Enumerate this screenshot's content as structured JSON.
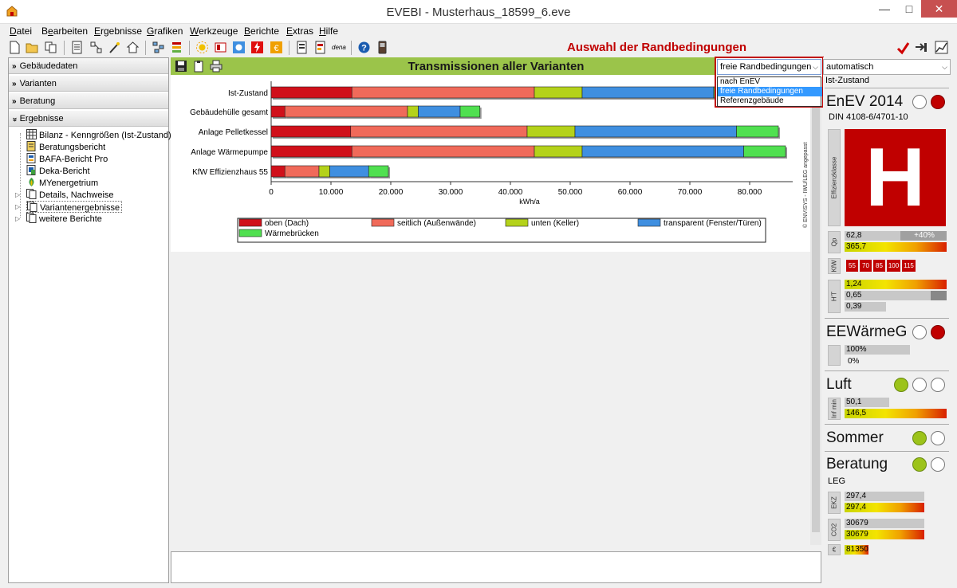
{
  "window": {
    "title": "EVEBI - Musterhaus_18599_6.eve",
    "min": "—",
    "max": "□",
    "close": "✕"
  },
  "menu": {
    "items": [
      {
        "pre": "",
        "u": "D",
        "post": "atei"
      },
      {
        "pre": "B",
        "u": "e",
        "post": "arbeiten"
      },
      {
        "pre": "",
        "u": "E",
        "post": "rgebnisse"
      },
      {
        "pre": "",
        "u": "G",
        "post": "rafiken"
      },
      {
        "pre": "",
        "u": "W",
        "post": "erkzeuge"
      },
      {
        "pre": "",
        "u": "B",
        "post": "erichte"
      },
      {
        "pre": "",
        "u": "E",
        "post": "xtras"
      },
      {
        "pre": "",
        "u": "H",
        "post": "ilfe"
      }
    ]
  },
  "toolbar": {
    "heading": "Auswahl der Randbedingungen",
    "dena_label": "dena"
  },
  "leftpanel": {
    "sections": [
      "Gebäudedaten",
      "Varianten",
      "Beratung",
      "Ergebnisse"
    ],
    "tree": [
      "Bilanz - Kenngrößen (Ist-Zustand)",
      "Beratungsbericht",
      "BAFA-Bericht Pro",
      "Deka-Bericht",
      "MYenergetrium",
      "Details, Nachweise",
      "Variantenergebnisse",
      "weitere Berichte"
    ]
  },
  "main": {
    "title": "Transmissionen aller Varianten",
    "dropdown": {
      "selected": "freie Randbedingungen",
      "options": [
        "nach EnEV",
        "freie Randbedingungen",
        "Referenzgebäude"
      ]
    }
  },
  "chart_data": {
    "type": "bar",
    "orientation": "horizontal",
    "stacked": true,
    "categories": [
      "Ist-Zustand",
      "Gebäudehülle gesamt",
      "Anlage Pelletkessel",
      "Anlage Wärmepumpe",
      "KfW Effizienzhaus 55"
    ],
    "series": [
      {
        "name": "oben (Dach)",
        "color": "#d0101a",
        "values": [
          13500,
          2300,
          13300,
          13500,
          2300
        ]
      },
      {
        "name": "seitlich (Außenwände)",
        "color": "#f06a5a",
        "values": [
          30500,
          20500,
          29500,
          30500,
          5700
        ]
      },
      {
        "name": "unten (Keller)",
        "color": "#b4d21a",
        "values": [
          8000,
          1800,
          8000,
          8000,
          1800
        ]
      },
      {
        "name": "transparent (Fenster/Türen)",
        "color": "#3f8fe0",
        "values": [
          22000,
          7000,
          27000,
          27000,
          6500
        ]
      },
      {
        "name": "Wärmebrücken",
        "color": "#50e050",
        "values": [
          12800,
          3300,
          7000,
          7000,
          3300
        ]
      }
    ],
    "xticks": [
      "0",
      "10.000",
      "20.000",
      "30.000",
      "40.000",
      "50.000",
      "60.000",
      "70.000",
      "80.000"
    ],
    "xlabel": "kWh/a",
    "xlim": [
      0,
      87000
    ],
    "grid": false,
    "legend_position": "bottom",
    "watermark": "© ENVISYS - IWU/LEG angepasst"
  },
  "right": {
    "select": "automatisch",
    "variant": "Ist-Zustand",
    "enev": {
      "title": "EnEV 2014",
      "norm": "DIN 4108-6/4701-10",
      "class_label": "Effizienzklasse",
      "class": "H"
    },
    "qp": {
      "tag": "Qp",
      "value1": "62,8",
      "delta": "+40%",
      "value2": "365,7"
    },
    "kfw": {
      "tag": "KfW",
      "levels": [
        "55",
        "70",
        "85",
        "100",
        "115"
      ]
    },
    "ht": {
      "tag": "H'T",
      "values": [
        "1,24",
        "0,65",
        "0,39"
      ]
    },
    "eew": {
      "title": "EEWärmeG",
      "values": [
        "100%",
        "0%"
      ]
    },
    "luft": {
      "title": "Luft",
      "tag": "Inf min",
      "values": [
        "50,1",
        "146,5"
      ]
    },
    "sommer": {
      "title": "Sommer"
    },
    "beratung": {
      "title": "Beratung",
      "sub": "LEG"
    },
    "ekz": {
      "tag": "EKZ",
      "values": [
        "297,4",
        "297,4"
      ]
    },
    "co2": {
      "tag": "CO2",
      "values": [
        "30679",
        "30679"
      ]
    },
    "euro": {
      "tag": "€",
      "value": "81350"
    }
  }
}
